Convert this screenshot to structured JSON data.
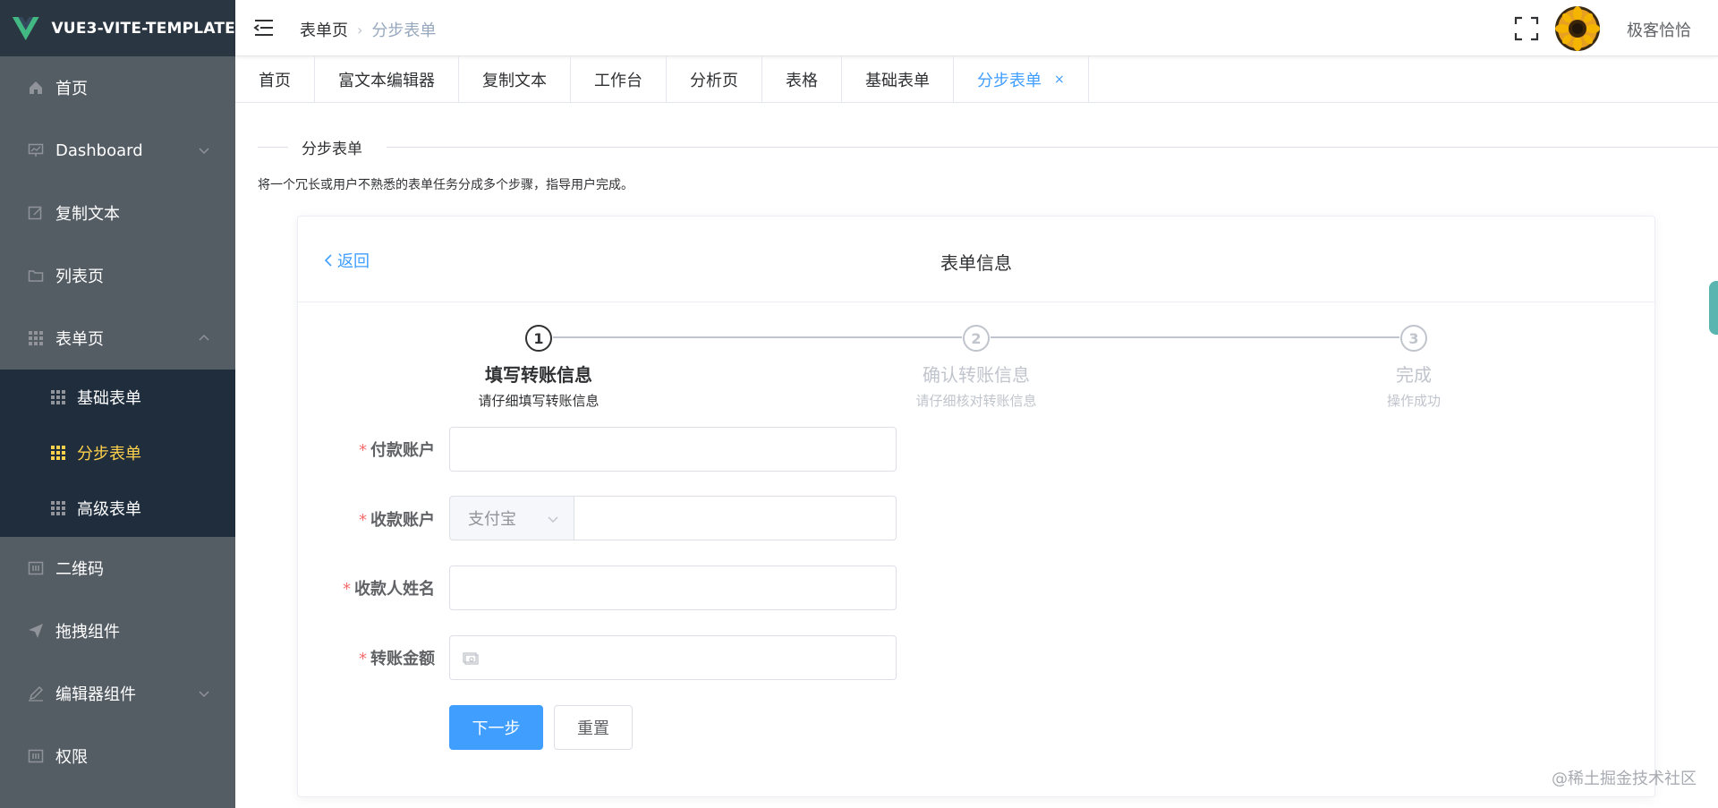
{
  "app": {
    "name": "VUE3-VITE-TEMPLATE"
  },
  "colors": {
    "sidebar_bg": "#545c64",
    "submenu_bg": "#1f2d3d",
    "active_menu": "#ffd04b",
    "primary": "#409eff",
    "required": "#f56c6c"
  },
  "sidebar": {
    "items": [
      {
        "label": "首页",
        "icon": "home-icon"
      },
      {
        "label": "Dashboard",
        "icon": "dashboard-icon",
        "expandable": true
      },
      {
        "label": "复制文本",
        "icon": "edit-icon"
      },
      {
        "label": "列表页",
        "icon": "folder-icon"
      },
      {
        "label": "表单页",
        "icon": "grid-icon",
        "expanded": true
      },
      {
        "label": "二维码",
        "icon": "qrcode-icon"
      },
      {
        "label": "拖拽组件",
        "icon": "send-icon"
      },
      {
        "label": "编辑器组件",
        "icon": "pen-icon",
        "expandable": true
      },
      {
        "label": "权限",
        "icon": "lock-icon"
      }
    ],
    "subitems": [
      {
        "label": "基础表单",
        "icon": "grid-icon"
      },
      {
        "label": "分步表单",
        "icon": "grid-icon",
        "active": true
      },
      {
        "label": "高级表单",
        "icon": "grid-icon"
      }
    ]
  },
  "header": {
    "breadcrumb": [
      "表单页",
      "分步表单"
    ],
    "username": "极客恰恰"
  },
  "tabs": [
    {
      "label": "首页"
    },
    {
      "label": "富文本编辑器"
    },
    {
      "label": "复制文本"
    },
    {
      "label": "工作台"
    },
    {
      "label": "分析页"
    },
    {
      "label": "表格"
    },
    {
      "label": "基础表单"
    },
    {
      "label": "分步表单",
      "active": true,
      "close": "×"
    }
  ],
  "page": {
    "divider_title": "分步表单",
    "description": "将一个冗长或用户不熟悉的表单任务分成多个步骤，指导用户完成。"
  },
  "card": {
    "back": "返回",
    "title": "表单信息"
  },
  "steps": [
    {
      "number": "1",
      "title": "填写转账信息",
      "desc": "请仔细填写转账信息",
      "active": true
    },
    {
      "number": "2",
      "title": "确认转账信息",
      "desc": "请仔细核对转账信息"
    },
    {
      "number": "3",
      "title": "完成",
      "desc": "操作成功"
    }
  ],
  "form": {
    "required_mark": "*",
    "payer_label": "付款账户",
    "payee_label": "收款账户",
    "payee_type": "支付宝",
    "payee_name_label": "收款人姓名",
    "amount_label": "转账金额"
  },
  "buttons": {
    "next": "下一步",
    "reset": "重置"
  },
  "watermark": "@稀土掘金技术社区"
}
